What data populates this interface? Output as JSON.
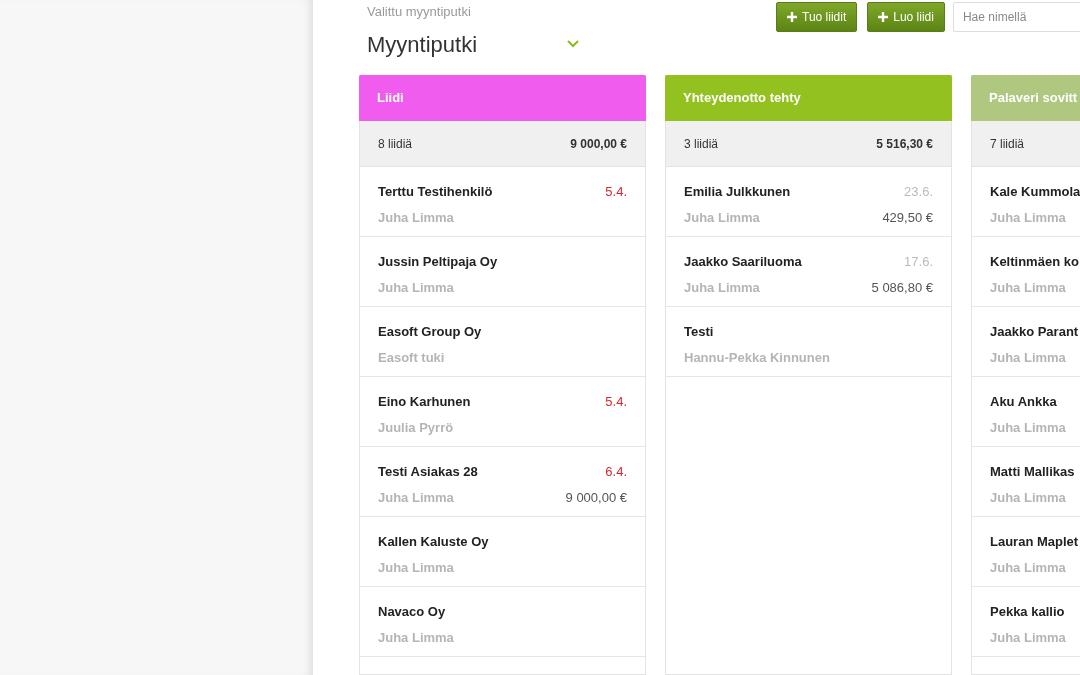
{
  "pipeline": {
    "label": "Valittu myyntiputki",
    "value": "Myyntiputki"
  },
  "buttons": [
    {
      "label": "Tuo liidit"
    },
    {
      "label": "Luo liidi"
    }
  ],
  "search": {
    "placeholder": "Hae nimellä"
  },
  "columns": [
    {
      "title": "Liidi",
      "color": "#f05ced",
      "count": "8 liidiä",
      "total": "9 000,00 €",
      "cards": [
        {
          "name": "Terttu Testihenkilö",
          "owner": "Juha Limma",
          "date": "5.4.",
          "overdue": true
        },
        {
          "name": "Jussin Peltipaja Oy",
          "owner": "Juha Limma"
        },
        {
          "name": "Easoft Group Oy",
          "owner": "Easoft tuki"
        },
        {
          "name": "Eino Karhunen",
          "owner": "Juulia Pyrrö",
          "date": "5.4.",
          "overdue": true
        },
        {
          "name": "Testi Asiakas 28",
          "owner": "Juha Limma",
          "date": "6.4.",
          "overdue": true,
          "amount": "9 000,00 €"
        },
        {
          "name": "Kallen Kaluste Oy",
          "owner": "Juha Limma"
        },
        {
          "name": "Navaco Oy",
          "owner": "Juha Limma"
        }
      ]
    },
    {
      "title": "Yhteydenotto tehty",
      "color": "#93c11f",
      "count": "3 liidiä",
      "total": "5 516,30 €",
      "cards": [
        {
          "name": "Emilia Julkkunen",
          "owner": "Juha Limma",
          "date": "23.6.",
          "overdue": false,
          "amount": "429,50 €"
        },
        {
          "name": "Jaakko Saariluoma",
          "owner": "Juha Limma",
          "date": "17.6.",
          "overdue": false,
          "amount": "5 086,80 €"
        },
        {
          "name": "Testi",
          "owner": "Hannu-Pekka Kinnunen"
        }
      ]
    },
    {
      "title": "Palaveri sovitt",
      "color": "#b0c77f",
      "count": "7 liidiä",
      "cards": [
        {
          "name": "Kale Kummola",
          "owner": "Juha Limma"
        },
        {
          "name": "Keltinmäen ko",
          "owner": "Juha Limma"
        },
        {
          "name": "Jaakko Parant",
          "owner": "Juha Limma"
        },
        {
          "name": "Aku Ankka",
          "owner": "Juha Limma"
        },
        {
          "name": "Matti Mallikas",
          "owner": "Juha Limma"
        },
        {
          "name": "Lauran Maplet",
          "owner": "Juha Limma"
        },
        {
          "name": "Pekka kallio",
          "owner": "Juha Limma"
        }
      ]
    }
  ]
}
